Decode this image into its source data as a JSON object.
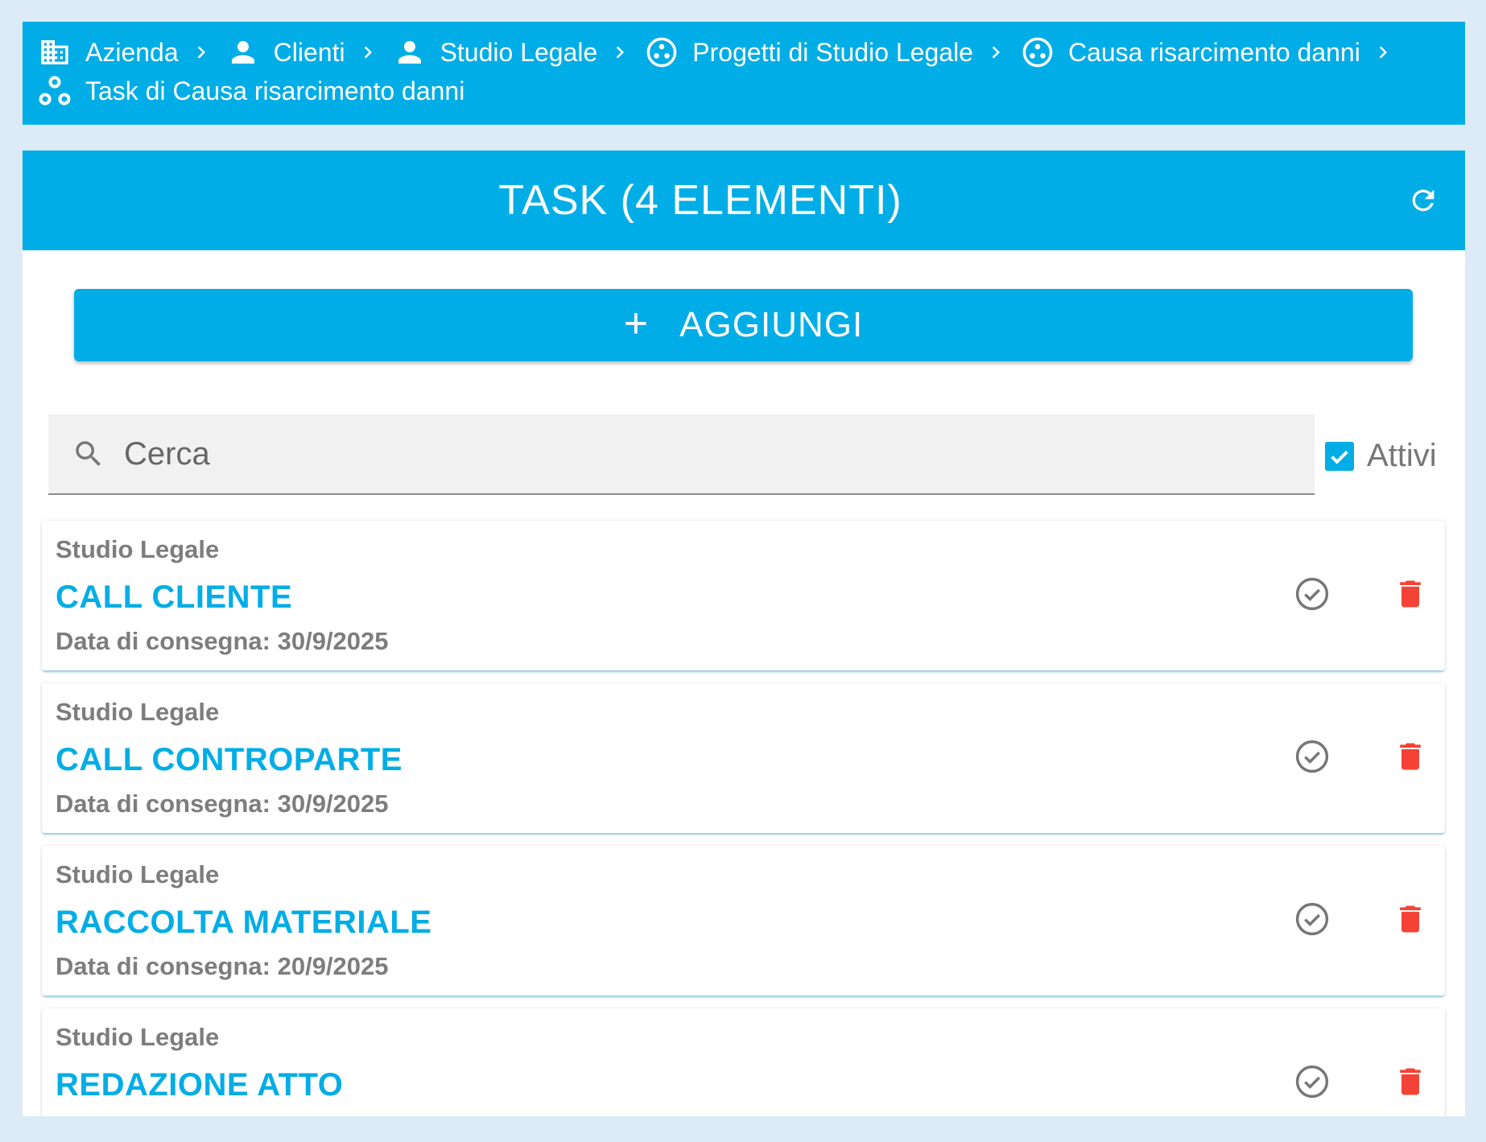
{
  "breadcrumb": [
    {
      "icon": "business-icon",
      "label": "Azienda"
    },
    {
      "icon": "person-icon",
      "label": "Clienti"
    },
    {
      "icon": "person-icon",
      "label": "Studio Legale"
    },
    {
      "icon": "workspaces-icon",
      "label": "Progetti di Studio Legale"
    },
    {
      "icon": "workspaces-icon",
      "label": "Causa risarcimento danni"
    },
    {
      "icon": "bubble-chart-icon",
      "label": "Task di Causa risarcimento danni"
    }
  ],
  "header": {
    "title": "TASK (4 ELEMENTI)"
  },
  "add_button": {
    "label": "AGGIUNGI"
  },
  "search": {
    "placeholder": "Cerca"
  },
  "filter": {
    "label": "Attivi",
    "checked": true
  },
  "tasks": [
    {
      "company": "Studio Legale",
      "name": "CALL CLIENTE",
      "due": "Data di consegna: 30/9/2025"
    },
    {
      "company": "Studio Legale",
      "name": "CALL CONTROPARTE",
      "due": "Data di consegna: 30/9/2025"
    },
    {
      "company": "Studio Legale",
      "name": "RACCOLTA MATERIALE",
      "due": "Data di consegna: 20/9/2025"
    },
    {
      "company": "Studio Legale",
      "name": "REDAZIONE ATTO",
      "due": ""
    }
  ],
  "colors": {
    "primary": "#01ade6",
    "delete": "#f44336",
    "background": "#dcebf5"
  }
}
